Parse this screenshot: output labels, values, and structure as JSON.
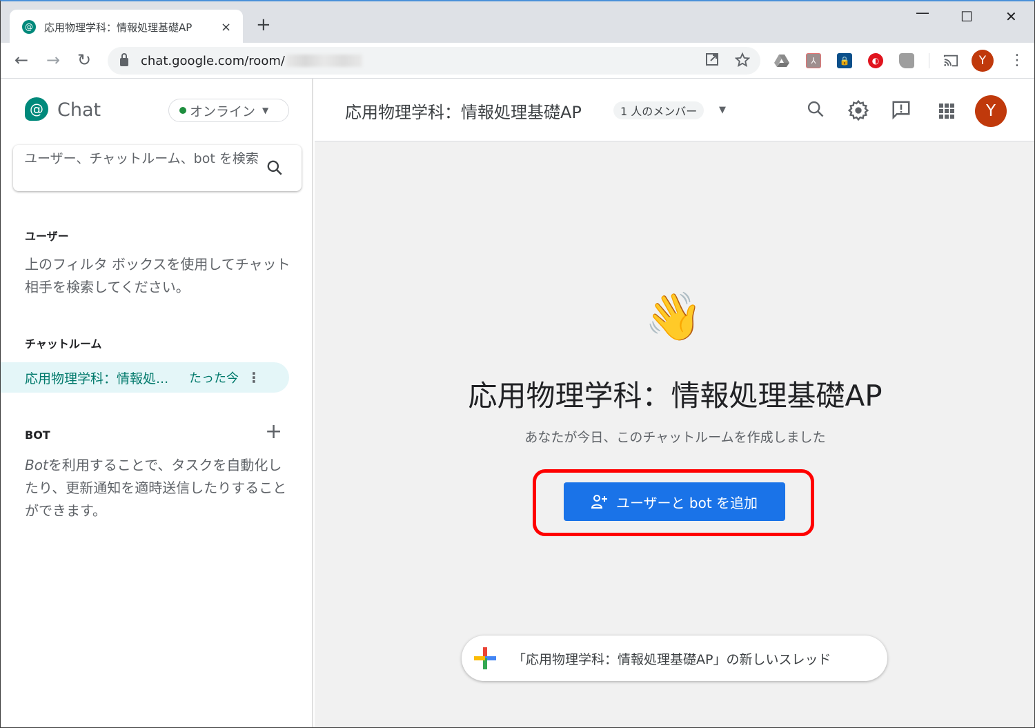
{
  "browser": {
    "tab_title": "応用物理学科：情報処理基礎AP",
    "tab_close": "×",
    "new_tab": "+",
    "url": "chat.google.com/room/",
    "window_controls": {
      "minimize": "—",
      "maximize": "☐",
      "close": "✕"
    },
    "nav": {
      "back": "←",
      "forward": "→",
      "reload": "↻"
    },
    "profile_initial": "Y",
    "extensions": [
      "google-drive",
      "adobe-acrobat",
      "password-manager",
      "trend-micro",
      "unknown-extension"
    ]
  },
  "sidebar": {
    "app_name": "Chat",
    "status": {
      "label": "オンライン",
      "color": "#1e8e3e"
    },
    "search_placeholder": "ユーザー、チャットルーム、bot を検索",
    "users": {
      "title": "ユーザー",
      "hint": "上のフィルタ ボックスを使用してチャット相手を検索してください。"
    },
    "rooms": {
      "title": "チャットルーム",
      "items": [
        {
          "name": "応用物理学科：情報処...",
          "time": "たった今"
        }
      ]
    },
    "bots": {
      "title": "BOT",
      "hint_italic": "Bot",
      "hint": "を利用することで、タスクを自動化したり、更新通知を適時送信したりすることができます。"
    }
  },
  "main": {
    "header": {
      "room_title": "応用物理学科：情報処理基礎AP",
      "member_count": "1 人のメンバー",
      "profile_initial": "Y"
    },
    "welcome": {
      "emoji": "👋",
      "title": "応用物理学科：情報処理基礎AP",
      "subtitle": "あなたが今日、このチャットルームを作成しました",
      "add_button": "ユーザーと bot を追加"
    },
    "new_thread_label": "「応用物理学科：情報処理基礎AP」の新しいスレッド"
  },
  "colors": {
    "accent_blue": "#1a73e8",
    "chat_teal": "#00897b",
    "avatar": "#c0390b",
    "highlight_red": "#ff0000"
  }
}
